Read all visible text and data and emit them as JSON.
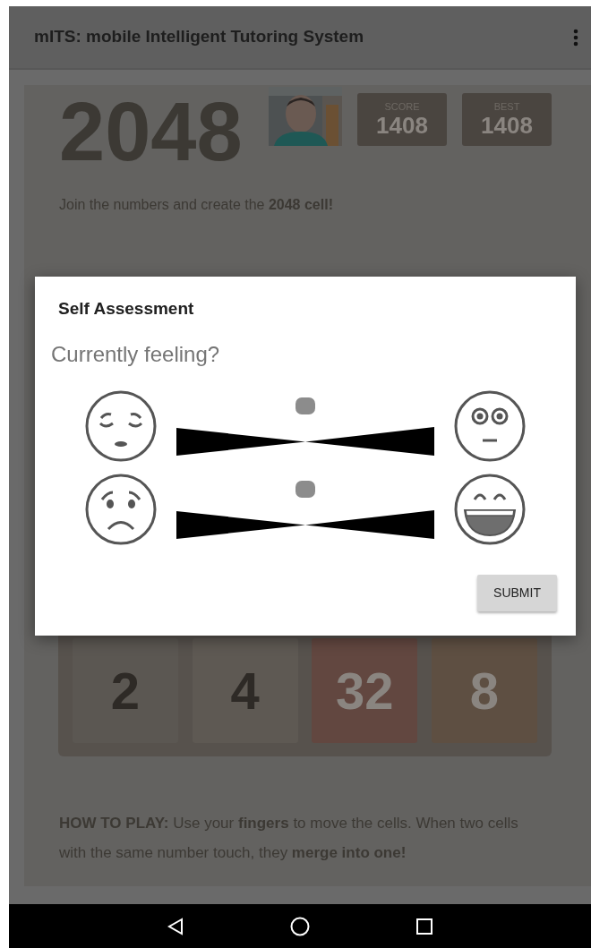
{
  "app_bar": {
    "title": "mITS: mobile Intelligent Tutoring System"
  },
  "game": {
    "title": "2048",
    "scores": [
      {
        "label": "SCORE",
        "value": "1408"
      },
      {
        "label": "BEST",
        "value": "1408"
      }
    ],
    "intro": "Join the numbers and create the **2048 cell!**",
    "tiles": [
      {
        "value": "2",
        "color": "#5b5752"
      },
      {
        "value": "4",
        "color": "#5e5953"
      },
      {
        "value": "32",
        "color": "#624740"
      },
      {
        "value": "8",
        "color": "#5e4f42"
      }
    ],
    "how_to_play": "**HOW TO PLAY:** Use your **fingers** to move the cells. When two cells with the same number touch, they **merge into one!**"
  },
  "dialog": {
    "title": "Self Assessment",
    "question": "Currently feeling?",
    "sliders": [
      {
        "level": 0.5
      },
      {
        "level": 0.5
      }
    ],
    "submit": "SUBMIT"
  }
}
